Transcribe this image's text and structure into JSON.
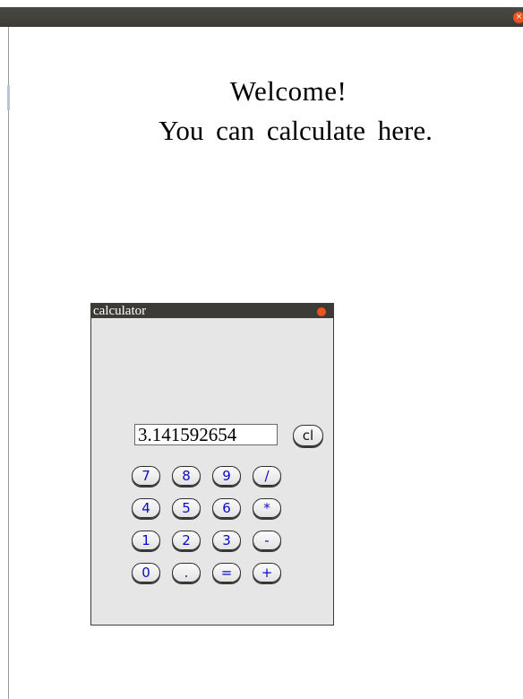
{
  "window": {
    "close_glyph": "×"
  },
  "welcome": {
    "line1": "Welcome!",
    "line2": "You can calculate here."
  },
  "calculator": {
    "title": "calculator",
    "display_value": "3.141592654",
    "clear_label": "cl",
    "keys": {
      "k7": "7",
      "k8": "8",
      "k9": "9",
      "div": "/",
      "k4": "4",
      "k5": "5",
      "k6": "6",
      "mul": "*",
      "k1": "1",
      "k2": "2",
      "k3": "3",
      "sub": "-",
      "k0": "0",
      "dot": ".",
      "eq": "=",
      "add": "+"
    }
  },
  "colors": {
    "titlebar": "#3c3b37",
    "close_button": "#e95420",
    "key_text": "#0a0ac8",
    "calculator_body": "#e6e6e6"
  }
}
